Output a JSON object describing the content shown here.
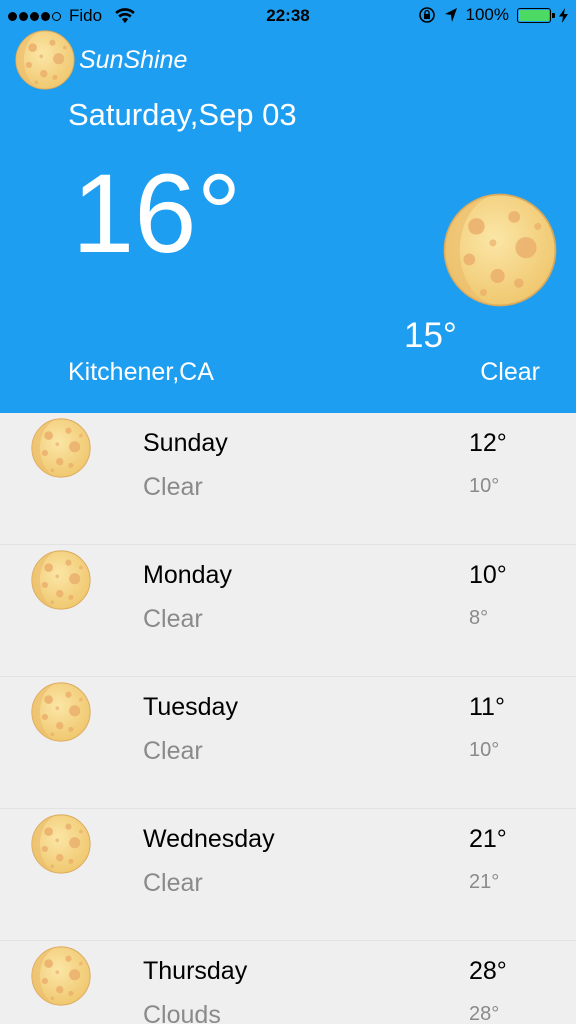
{
  "status_bar": {
    "carrier": "Fido",
    "time": "22:38",
    "battery": "100%",
    "battery_level": 1.0,
    "icons": [
      "signal-dots",
      "wifi-icon",
      "rotation-lock-icon",
      "location-arrow-icon",
      "battery-icon",
      "charging-bolt-icon"
    ]
  },
  "app": {
    "name": "SunShine",
    "logo_icon": "moon-icon"
  },
  "today": {
    "date": "Saturday,Sep 03",
    "high": "16°",
    "low": "15°",
    "location": "Kitchener,CA",
    "condition": "Clear",
    "icon": "moon-icon"
  },
  "forecast": [
    {
      "day": "Sunday",
      "condition": "Clear",
      "high": "12°",
      "low": "10°"
    },
    {
      "day": "Monday",
      "condition": "Clear",
      "high": "10°",
      "low": "8°"
    },
    {
      "day": "Tuesday",
      "condition": "Clear",
      "high": "11°",
      "low": "10°"
    },
    {
      "day": "Wednesday",
      "condition": "Clear",
      "high": "21°",
      "low": "21°"
    },
    {
      "day": "Thursday",
      "condition": "Clouds",
      "high": "28°",
      "low": "28°"
    }
  ],
  "colors": {
    "header_bg": "#1e9ef0",
    "list_bg": "#efefef",
    "battery_green": "#4cd964",
    "muted_text": "#8a8a8a"
  }
}
